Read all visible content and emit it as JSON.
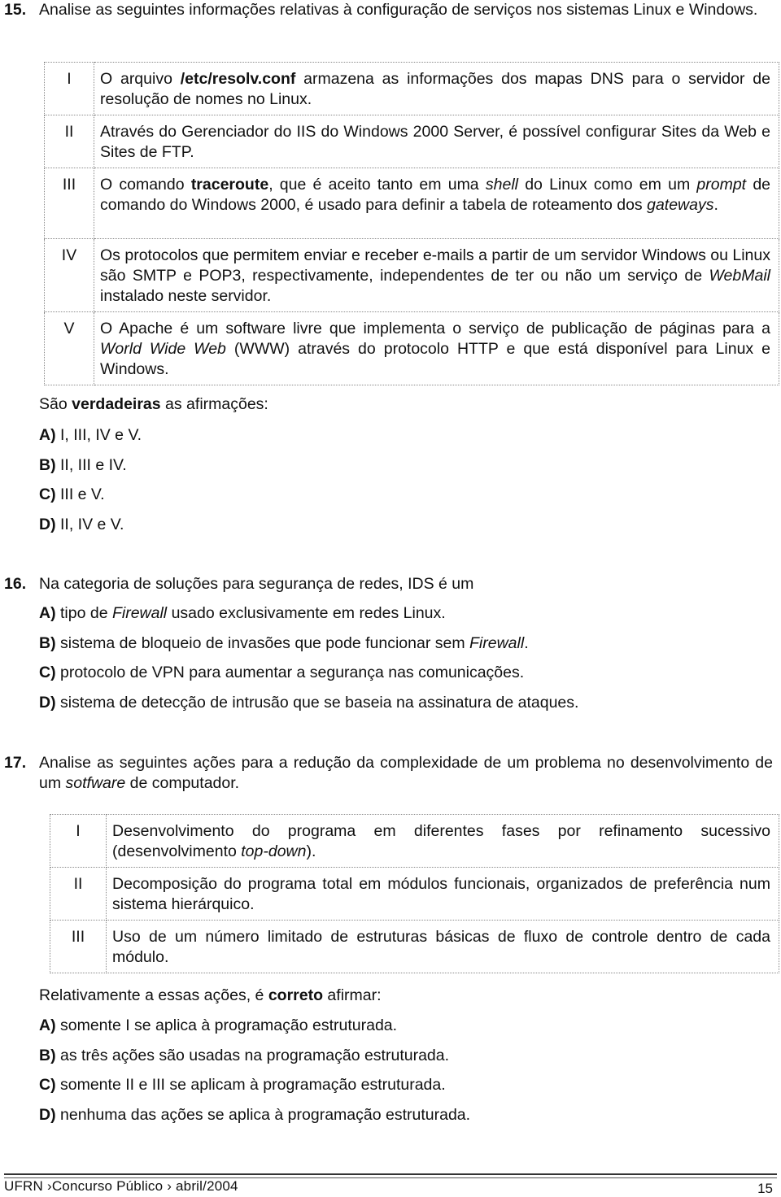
{
  "q15": {
    "number": "15.",
    "prompt": "Analise as seguintes informações relativas à configuração de serviços nos sistemas Linux e Windows.",
    "statements": [
      {
        "roman": "I",
        "parts": [
          [
            "O arquivo ",
            ""
          ],
          [
            "/etc/resolv.conf",
            "b"
          ],
          [
            " armazena as informações dos mapas DNS para o servidor de resolução de nomes no Linux.",
            ""
          ]
        ]
      },
      {
        "roman": "II",
        "parts": [
          [
            "Através do Gerenciador do IIS do Windows 2000 Server, é possível configurar Sites da Web e Sites de FTP.",
            ""
          ]
        ]
      },
      {
        "roman": "III",
        "parts": [
          [
            "O comando ",
            ""
          ],
          [
            "traceroute",
            "b"
          ],
          [
            ", que é aceito tanto em uma ",
            ""
          ],
          [
            "shell",
            "i"
          ],
          [
            " do Linux como em um ",
            ""
          ],
          [
            "prompt",
            "i"
          ],
          [
            " de comando do Windows 2000, é usado para definir a tabela de roteamento dos ",
            ""
          ],
          [
            "gateways",
            "i"
          ],
          [
            ".",
            ""
          ]
        ]
      },
      {
        "roman": "IV",
        "parts": [
          [
            "Os protocolos que permitem enviar e receber e-mails a partir de um servidor Windows ou Linux são SMTP e POP3, respectivamente, independentes de ter ou não um serviço de ",
            ""
          ],
          [
            "WebMail",
            "i"
          ],
          [
            " instalado neste servidor.",
            ""
          ]
        ]
      },
      {
        "roman": "V",
        "parts": [
          [
            "O Apache é um software livre que implementa o serviço de publicação de páginas para a ",
            ""
          ],
          [
            "World Wide Web",
            "i"
          ],
          [
            " (WWW) através do protocolo HTTP e que está disponível para Linux e Windows.",
            ""
          ]
        ]
      }
    ],
    "stem": {
      "pre": "São ",
      "bold": "verdadeiras",
      "post": " as afirmações:"
    },
    "options": [
      {
        "letter": "A)",
        "text": "I, III, IV e V."
      },
      {
        "letter": "B)",
        "text": "II, III e IV."
      },
      {
        "letter": "C)",
        "text": "III e V."
      },
      {
        "letter": "D)",
        "text": "II, IV e V."
      }
    ]
  },
  "q16": {
    "number": "16.",
    "prompt": "Na categoria de soluções para segurança de redes, IDS é um",
    "options": [
      {
        "letter": "A)",
        "parts": [
          [
            "tipo de ",
            ""
          ],
          [
            "Firewall",
            "i"
          ],
          [
            " usado exclusivamente em redes Linux.",
            ""
          ]
        ]
      },
      {
        "letter": "B)",
        "parts": [
          [
            "sistema de bloqueio de invasões que pode funcionar sem ",
            ""
          ],
          [
            "Firewall",
            "i"
          ],
          [
            ".",
            ""
          ]
        ]
      },
      {
        "letter": "C)",
        "parts": [
          [
            "protocolo de VPN para aumentar a segurança nas comunicações.",
            ""
          ]
        ]
      },
      {
        "letter": "D)",
        "parts": [
          [
            "sistema de detecção de intrusão que se baseia na assinatura de ataques.",
            ""
          ]
        ]
      }
    ]
  },
  "q17": {
    "number": "17.",
    "prompt_parts": [
      [
        "Analise as seguintes ações para a redução da complexidade de um problema no desenvolvimento de um ",
        ""
      ],
      [
        "sotfware",
        "i"
      ],
      [
        " de computador.",
        ""
      ]
    ],
    "statements": [
      {
        "roman": "I",
        "parts": [
          [
            "Desenvolvimento do programa em diferentes fases por refinamento sucessivo (desenvolvimento ",
            ""
          ],
          [
            "top-down",
            "i"
          ],
          [
            ").",
            ""
          ]
        ]
      },
      {
        "roman": "II",
        "parts": [
          [
            "Decomposição do programa total em módulos funcionais, organizados de preferência num sistema hierárquico.",
            ""
          ]
        ]
      },
      {
        "roman": "III",
        "parts": [
          [
            "Uso de um número limitado de estruturas básicas de fluxo de controle dentro de cada módulo.",
            ""
          ]
        ]
      }
    ],
    "stem": {
      "pre": "Relativamente a essas ações, é ",
      "bold": "correto",
      "post": " afirmar:"
    },
    "options": [
      {
        "letter": "A)",
        "text": "somente I se aplica à programação estruturada."
      },
      {
        "letter": "B)",
        "text": "as três ações são usadas na programação estruturada."
      },
      {
        "letter": "C)",
        "text": "somente II e III se aplicam à programação estruturada."
      },
      {
        "letter": "D)",
        "text": "nenhuma das ações se aplica à programação estruturada."
      }
    ]
  },
  "footer": {
    "institution": "UFRN",
    "separator": "›",
    "exam": "Concurso Público",
    "date": "abril/2004",
    "page_number": "15"
  }
}
